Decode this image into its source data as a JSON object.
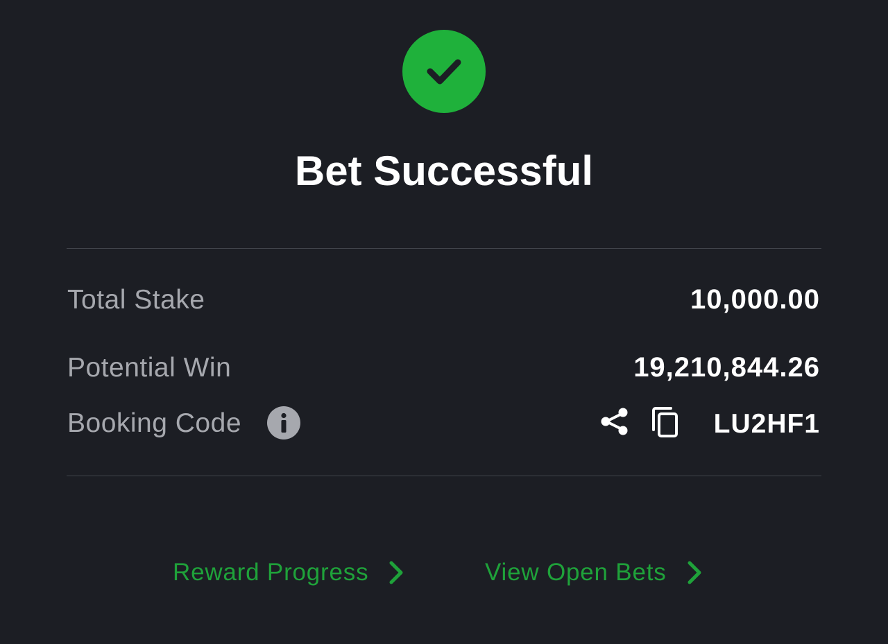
{
  "header": {
    "status_icon": "checkmark-circle-icon",
    "title": "Bet Successful"
  },
  "summary": {
    "total_stake_label": "Total Stake",
    "total_stake_value": "10,000.00",
    "potential_win_label": "Potential Win",
    "potential_win_value": "19,210,844.26",
    "booking_code_label": "Booking Code",
    "booking_code_value": "LU2HF1",
    "booking_icons": [
      "info-icon",
      "share-icon",
      "copy-icon"
    ]
  },
  "links": {
    "reward_progress": "Reward Progress",
    "view_open_bets": "View Open Bets"
  },
  "colors": {
    "background": "#1c1e24",
    "success": "#1fb13b",
    "accent_link": "#1fa23a",
    "muted_text": "#a6a8ae",
    "primary_text": "#ffffff"
  }
}
